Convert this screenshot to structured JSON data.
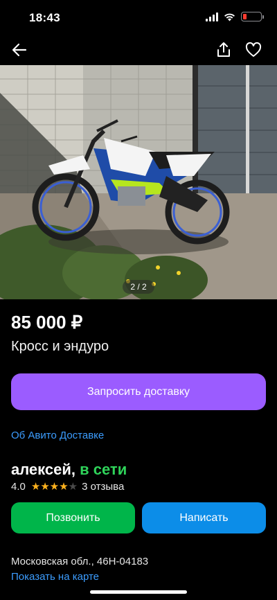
{
  "status_bar": {
    "time": "18:43",
    "icons": [
      "cellular-signal-icon",
      "wifi-icon",
      "battery-low-icon"
    ],
    "battery_color": "#ff3b30"
  },
  "nav": {
    "icons": [
      "back-arrow-icon",
      "share-icon",
      "favorite-heart-icon"
    ]
  },
  "gallery": {
    "counter": "2 / 2"
  },
  "listing": {
    "price": "85 000 ₽",
    "title": "Кросс и эндуро"
  },
  "delivery": {
    "button_label": "Запросить доставку",
    "about_link": "Об Авито Доставке",
    "button_color": "#9b5cff"
  },
  "seller": {
    "name": "алексей,",
    "status": "в сети",
    "rating_value": "4.0",
    "stars_filled": 4,
    "stars_total": 5,
    "reviews": "3 отзыва"
  },
  "actions": {
    "call_label": "Позвонить",
    "write_label": "Написать",
    "call_color": "#00b54a",
    "write_color": "#0c8de8"
  },
  "location": {
    "address": "Московская обл., 46Н-04183",
    "map_link": "Показать на карте"
  }
}
